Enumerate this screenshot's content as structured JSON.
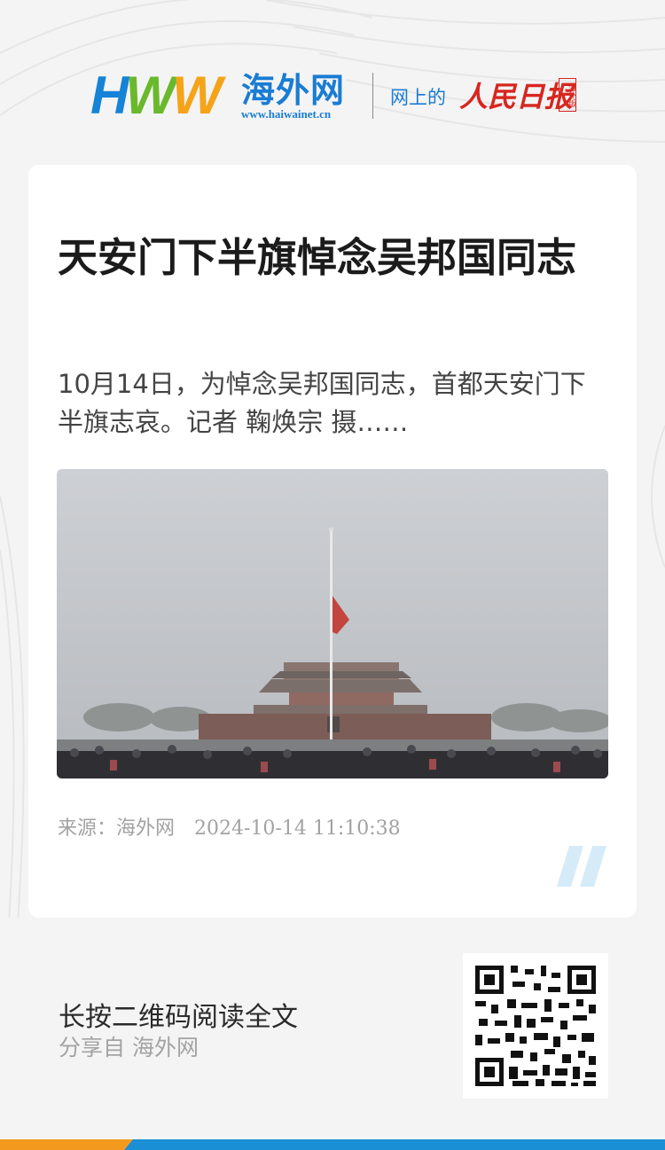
{
  "header": {
    "logo_letters": "HWW",
    "logo_cn": "海外网",
    "logo_url": "www.haiwainet.cn",
    "partner_prefix": "网上的",
    "partner_name": "人民日报",
    "partner_badge": "海外版"
  },
  "article": {
    "title": "天安门下半旗悼念吴邦国同志",
    "summary": "10月14日，为悼念吴邦国同志，首都天安门下半旗志哀。记者 鞠焕宗 摄……",
    "source": "来源：海外网",
    "datetime": "2024-10-14 11:10:38"
  },
  "footer": {
    "cta": "长按二维码阅读全文",
    "share": "分享自 海外网"
  },
  "colors": {
    "brand_blue": "#1a7cd3",
    "hww_green": "#6ab92d",
    "hww_orange": "#f5a319",
    "partner_red": "#d7261f",
    "bar_orange": "#f39a1e",
    "bar_blue": "#1b8fd6"
  },
  "icons": {
    "quote": "double-slash-quote-icon",
    "qr": "qr-code-icon"
  }
}
